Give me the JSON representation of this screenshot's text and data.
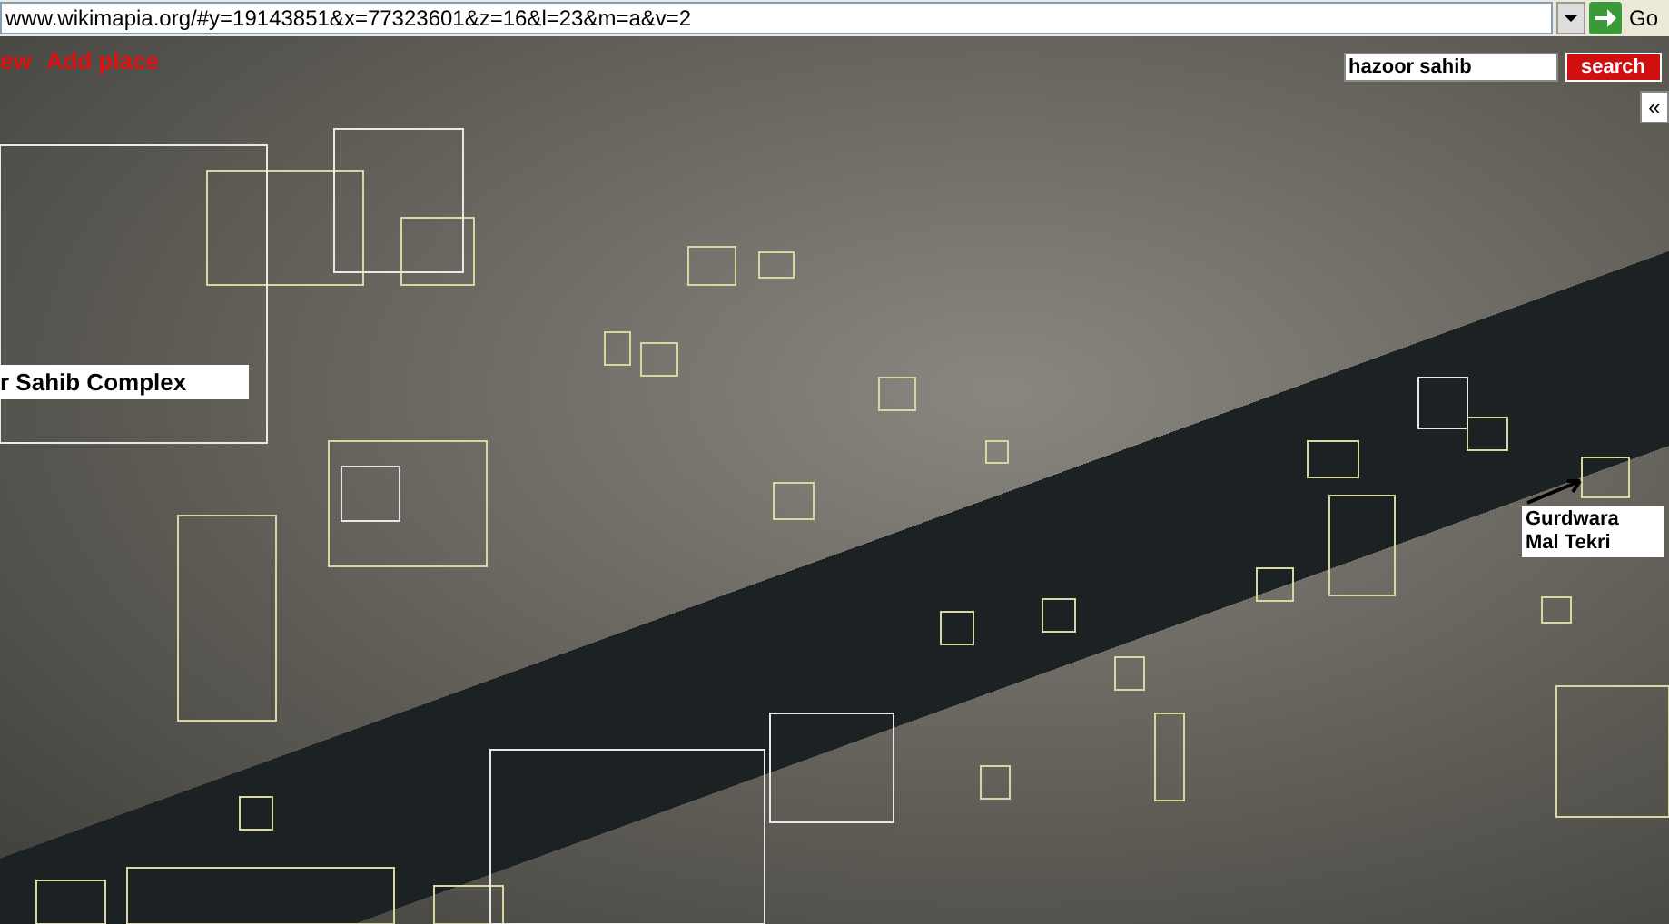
{
  "address_bar": {
    "url": "www.wikimapia.org/#y=19143851&x=77323601&z=16&l=23&m=a&v=2",
    "go_label": "Go"
  },
  "map": {
    "links": [
      "ew",
      "Add place"
    ],
    "search": {
      "value": "hazoor sahib",
      "button": "search"
    },
    "collapse": "«",
    "labels": [
      {
        "text": "r Sahib Complex"
      },
      {
        "text": "Gurdwara\nMal Tekri"
      }
    ]
  }
}
